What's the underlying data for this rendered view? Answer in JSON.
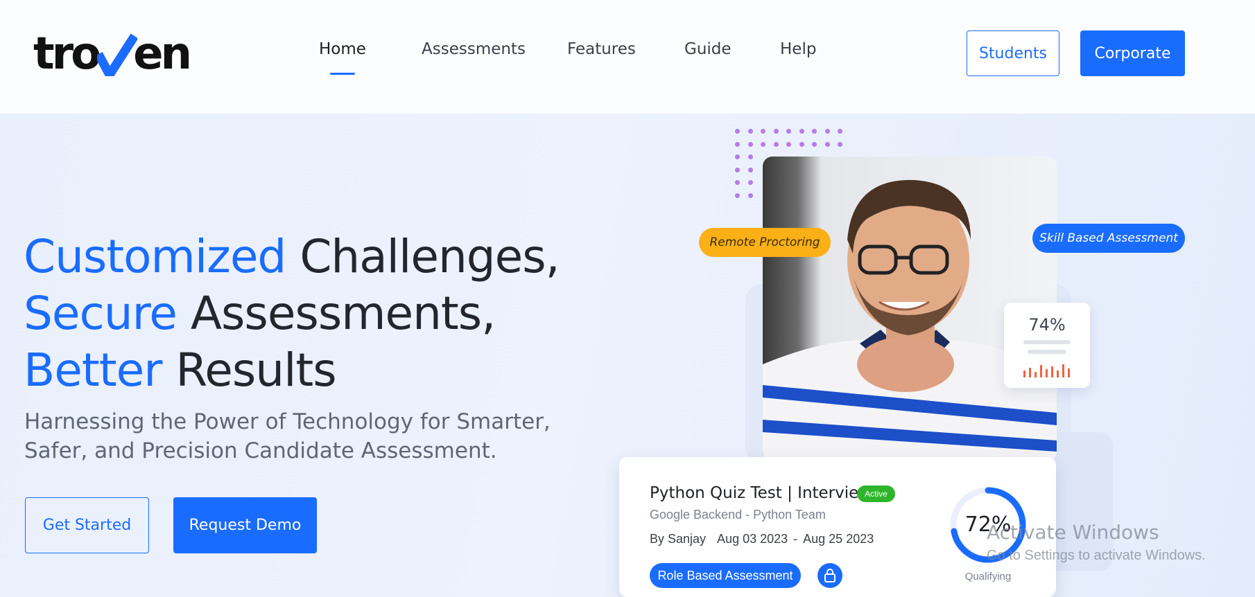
{
  "header": {
    "logo_text": "troven",
    "nav": [
      {
        "label": "Home",
        "active": true
      },
      {
        "label": "Assessments"
      },
      {
        "label": "Features"
      },
      {
        "label": "Guide"
      },
      {
        "label": "Help"
      }
    ],
    "students_label": "Students",
    "corporate_label": "Corporate"
  },
  "hero": {
    "line1_accent": "Customized",
    "line1_rest": " Challenges,",
    "line2_accent": "Secure",
    "line2_rest": " Assessments,",
    "line3_accent": "Better",
    "line3_rest": " Results",
    "subtext": "Harnessing the Power of Technology for Smarter, Safer, and Precision Candidate Assessment.",
    "get_started_label": "Get Started",
    "request_demo_label": "Request Demo"
  },
  "tags": {
    "remote_proctoring": "Remote Proctoring",
    "skill_based": "Skill Based Assessment"
  },
  "stat_card": {
    "percent_label": "74%"
  },
  "quiz_card": {
    "title": "Python Quiz Test | Interview",
    "status": "Active",
    "team": "Google Backend - Python Team",
    "author": "By Sanjay",
    "start_date": "Aug 03 2023",
    "date_separator": "-",
    "end_date": "Aug 25 2023",
    "type_label": "Role Based Assessment",
    "score_label": "72%",
    "score_value": 0.72,
    "score_caption": "Qualifying"
  },
  "watermark": {
    "line1": "Activate Windows",
    "line2": "Go to Settings to activate Windows."
  },
  "colors": {
    "brand_blue": "#1a6cff",
    "accent_yellow": "#fbb017",
    "active_green": "#2fb52c",
    "dots_purple": "#b77be8"
  }
}
